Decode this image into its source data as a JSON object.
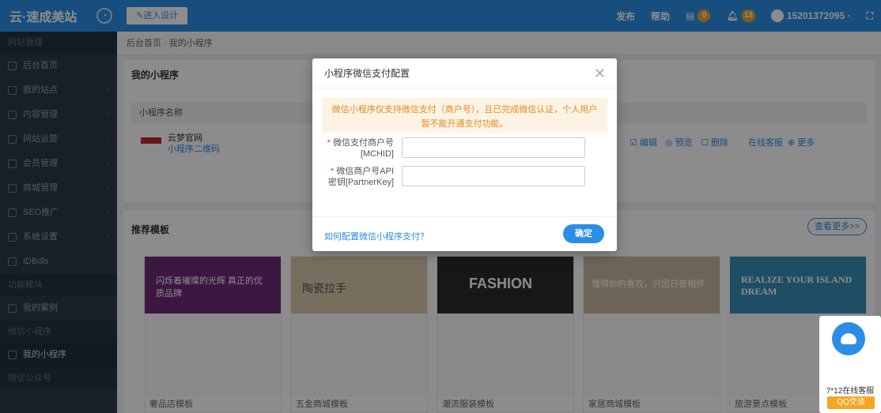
{
  "topbar": {
    "logo": "云·速成美站",
    "speed_icon": "gauge-icon",
    "design_button": "✎进入设计",
    "publish": "发布",
    "help": "帮助",
    "message_badge": "0",
    "notice_badge": "13",
    "account": "15201372095 ·"
  },
  "sidebar": {
    "group1": "网站管理",
    "items1": [
      {
        "label": "后台首页"
      },
      {
        "label": "我的站点"
      },
      {
        "label": "内容管理"
      },
      {
        "label": "网站运营"
      },
      {
        "label": "会员管理"
      },
      {
        "label": "商城管理"
      },
      {
        "label": "SEO推广"
      },
      {
        "label": "系统设置"
      },
      {
        "label": "IDBdls"
      }
    ],
    "group2": "功能模块",
    "items2": [
      {
        "label": "我的案例"
      }
    ],
    "group3": "微信小程序",
    "items3": [
      {
        "label": "我的小程序"
      }
    ],
    "group4": "微信公众号"
  },
  "breadcrumb": {
    "home": "后台首页",
    "sep": "·",
    "current": "我的小程序"
  },
  "panel1": {
    "title": "我的小程序",
    "col_name": "小程序名称",
    "row": {
      "name": "云梦官网",
      "qr": "小程序二维码",
      "act_edit": "☑ 编辑",
      "act_preview": "◎ 预览",
      "act_delete": "☐ 删除",
      "act_online": "在线客服",
      "act_more": "⊕ 更多"
    }
  },
  "panel2": {
    "title": "推荐模板",
    "more_button": "查看更多>>",
    "templates": [
      {
        "name": "奢品店模板",
        "hero_text": "闪烁着璀璨的光辉 真正的优质品牌",
        "color": "#7b2d7c"
      },
      {
        "name": "五金商城模板",
        "hero_text": "陶瓷拉手",
        "color": "#d9c9a9"
      },
      {
        "name": "潮流服装模板",
        "hero_text": "FASHION",
        "color": "#2b2b2b"
      },
      {
        "name": "家居商城模板",
        "hero_text": "懂得你的喜欢，只因日夜相伴",
        "color": "#c9b9a0"
      },
      {
        "name": "旅游景点模板",
        "hero_text": "REALIZE YOUR ISLAND DREAM",
        "color": "#3a8fb7"
      }
    ]
  },
  "modal": {
    "title": "小程序微信支付配置",
    "notice": "微信小程序仅支持微信支付（商户号），且已完成微信认证，个人用户暂不能开通支付功能。",
    "field1_label": "微信支付商户号[MCHID]",
    "field1_value": "",
    "field1_placeholder": "",
    "field2_label": "微信商户号API密钥[PartnerKey]",
    "field2_value": "",
    "field2_placeholder": "",
    "help_link": "如何配置微信小程序支付？",
    "ok_button": "确定"
  },
  "float_service": {
    "text": "7*12在线客服",
    "button": "QQ交谈"
  }
}
